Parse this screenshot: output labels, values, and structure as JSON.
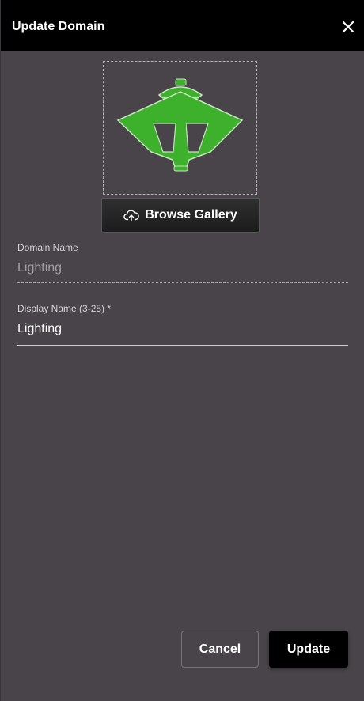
{
  "dialog": {
    "title": "Update Domain"
  },
  "image": {
    "icon": "green-lamp-post-icon"
  },
  "browse": {
    "label": "Browse Gallery",
    "icon": "cloud-upload-icon"
  },
  "fields": {
    "domain_name": {
      "label": "Domain Name",
      "value": "Lighting"
    },
    "display_name": {
      "label": "Display Name (3-25) *",
      "value": "Lighting"
    }
  },
  "actions": {
    "cancel_label": "Cancel",
    "update_label": "Update"
  },
  "colors": {
    "dialog_bg": "#48444a",
    "titlebar_bg": "#000000",
    "icon_green": "#3db02c"
  }
}
